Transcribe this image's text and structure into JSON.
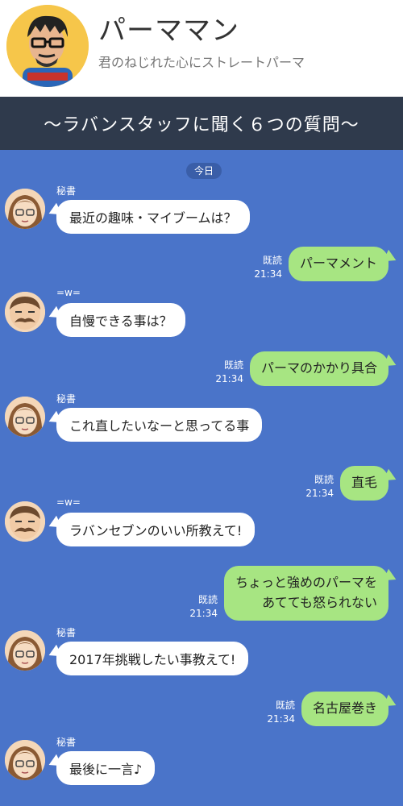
{
  "header": {
    "name": "パーママン",
    "tagline": "君のねじれた心にストレートパーマ"
  },
  "banner": {
    "title": "〜ラバンスタッフに聞く６つの質問〜"
  },
  "chat": {
    "date": "今日",
    "messages": [
      {
        "type": "in",
        "sender": "秘書",
        "avatar": "secretary",
        "text": "最近の趣味・マイブームは？"
      },
      {
        "type": "out",
        "read": "既読",
        "time": "21:34",
        "lines": [
          "パーマメント"
        ]
      },
      {
        "type": "in",
        "sender": "=w=",
        "avatar": "man",
        "text": "自慢できる事は？"
      },
      {
        "type": "out",
        "read": "既読",
        "time": "21:34",
        "lines": [
          "パーマのかかり具合"
        ]
      },
      {
        "type": "in",
        "sender": "秘書",
        "avatar": "secretary",
        "text": "これ直したいなーと思ってる事"
      },
      {
        "type": "out",
        "read": "既読",
        "time": "21:34",
        "lines": [
          "直毛"
        ]
      },
      {
        "type": "in",
        "sender": "=w=",
        "avatar": "man",
        "text": "ラバンセブンのいい所教えて!"
      },
      {
        "type": "out",
        "read": "既読",
        "time": "21:34",
        "lines": [
          "ちょっと強めのパーマを",
          "あてても怒られない"
        ]
      },
      {
        "type": "in",
        "sender": "秘書",
        "avatar": "secretary",
        "text": "2017年挑戦したい事教えて!"
      },
      {
        "type": "out",
        "read": "既読",
        "time": "21:34",
        "lines": [
          "名古屋巻き"
        ]
      },
      {
        "type": "in",
        "sender": "秘書",
        "avatar": "secretary",
        "text": "最後に一言♪"
      }
    ]
  }
}
